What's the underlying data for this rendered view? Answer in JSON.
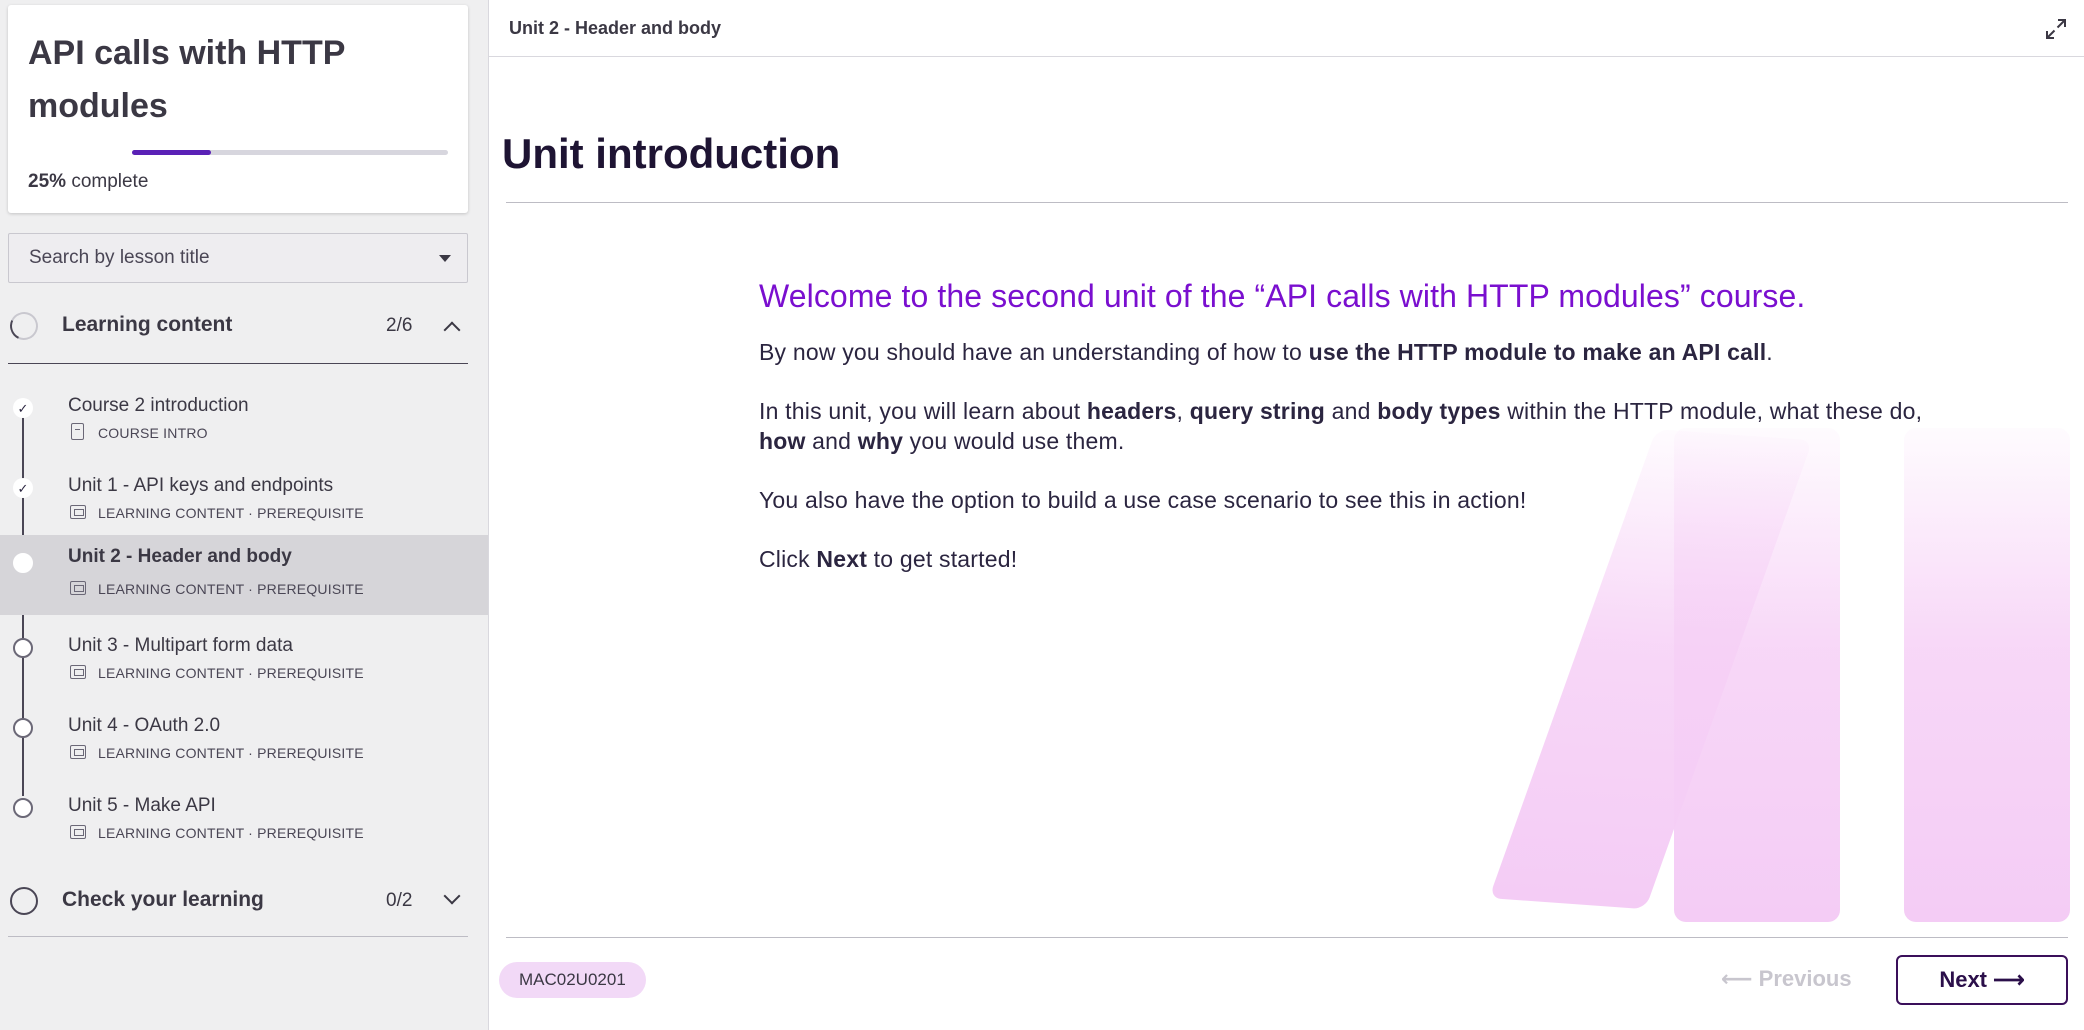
{
  "sidebar": {
    "course_title": "API calls with HTTP modules",
    "progress_percent": 25,
    "progress_value_text": "25%",
    "progress_suffix": "complete",
    "search_placeholder": "Search by lesson title",
    "sections": [
      {
        "title": "Learning content",
        "count": "2/6",
        "expanded": true,
        "lessons": [
          {
            "title": "Course 2 introduction",
            "meta": "COURSE INTRO",
            "status": "done",
            "icon": "document-icon"
          },
          {
            "title": "Unit 1 - API keys and endpoints",
            "meta": "LEARNING CONTENT · PREREQUISITE",
            "status": "done",
            "icon": "presentation-icon"
          },
          {
            "title": "Unit 2 - Header and body",
            "meta": "LEARNING CONTENT · PREREQUISITE",
            "status": "current",
            "icon": "presentation-icon"
          },
          {
            "title": "Unit 3 - Multipart form data",
            "meta": "LEARNING CONTENT · PREREQUISITE",
            "status": "todo",
            "icon": "presentation-icon"
          },
          {
            "title": "Unit 4 - OAuth 2.0",
            "meta": "LEARNING CONTENT · PREREQUISITE",
            "status": "todo",
            "icon": "presentation-icon"
          },
          {
            "title": "Unit 5 - Make API",
            "meta": "LEARNING CONTENT · PREREQUISITE",
            "status": "todo",
            "icon": "presentation-icon"
          }
        ]
      },
      {
        "title": "Check your learning",
        "count": "0/2",
        "expanded": false
      }
    ]
  },
  "main": {
    "topbar_title": "Unit 2 - Header and body",
    "heading": "Unit introduction",
    "welcome": "Welcome to the second unit of the “API calls with HTTP modules” course.",
    "p1_a": "By now you should have an understanding of how to ",
    "p1_b": "use the HTTP module to make an API call",
    "p1_c": ".",
    "p2_a": "In this unit, you will learn about ",
    "p2_b": "headers",
    "p2_c": ", ",
    "p2_d": "query string",
    "p2_e": " and ",
    "p2_f": "body types",
    "p2_g": " within the HTTP module, what these do, ",
    "p2_h": "how",
    "p2_i": " and ",
    "p2_j": "why",
    "p2_k": " you would use them.",
    "p3": "You also have the option to build a use case scenario to see this in action!",
    "p4_a": "Click ",
    "p4_b": "Next",
    "p4_c": " to get started!",
    "code": "MAC02U0201",
    "prev_label": "⟵ Previous",
    "next_label": "Next ⟶"
  },
  "colors": {
    "accent_purple": "#7a0fcf",
    "progress": "#5a21b6",
    "badge_bg": "#f2d9f7",
    "deco_pink": "#f4ccf5"
  }
}
